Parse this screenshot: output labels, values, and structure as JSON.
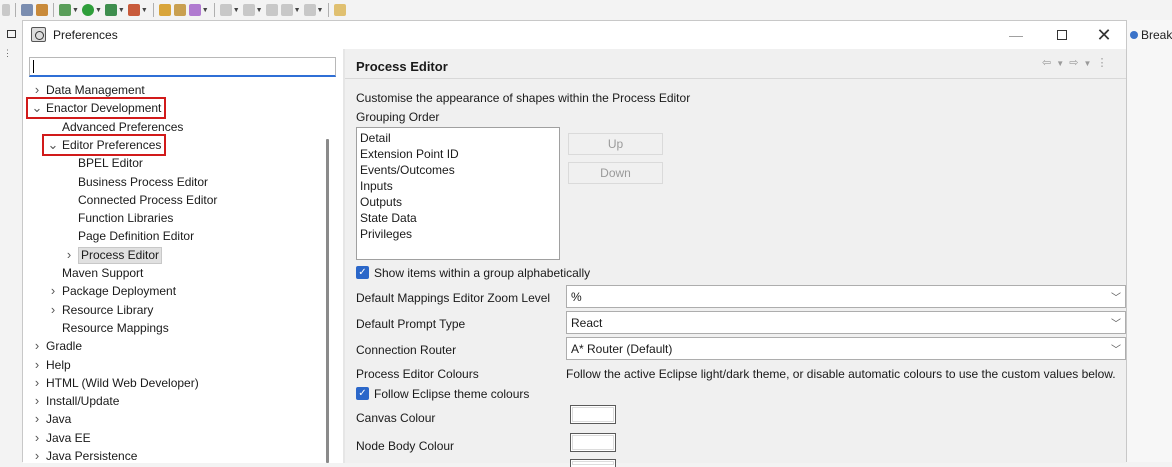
{
  "window": {
    "title": "Preferences",
    "minimize_icon": "minimize-icon",
    "maximize_icon": "maximize-icon",
    "close_icon": "close-icon"
  },
  "background": {
    "right_tab_label": "Breakp",
    "left_gutter_icon": "window-icon"
  },
  "filter": {
    "value": "",
    "placeholder": ""
  },
  "tree": [
    {
      "label": "Data Management",
      "expander": "collapsed"
    },
    {
      "label": "Enactor Development",
      "expander": "expanded",
      "highlighted": true
    },
    {
      "label": "Advanced Preferences",
      "expander": "none"
    },
    {
      "label": "Editor Preferences",
      "expander": "expanded",
      "highlighted": true
    },
    {
      "label": "BPEL Editor",
      "expander": "none"
    },
    {
      "label": "Business Process Editor",
      "expander": "none"
    },
    {
      "label": "Connected Process Editor",
      "expander": "none"
    },
    {
      "label": "Function Libraries",
      "expander": "none"
    },
    {
      "label": "Page Definition Editor",
      "expander": "none"
    },
    {
      "label": "Process Editor",
      "expander": "collapsed",
      "selected": true
    },
    {
      "label": "Maven Support",
      "expander": "none"
    },
    {
      "label": "Package Deployment",
      "expander": "collapsed"
    },
    {
      "label": "Resource Library",
      "expander": "collapsed"
    },
    {
      "label": "Resource Mappings",
      "expander": "none"
    },
    {
      "label": "Gradle",
      "expander": "collapsed"
    },
    {
      "label": "Help",
      "expander": "collapsed"
    },
    {
      "label": "HTML (Wild Web Developer)",
      "expander": "collapsed"
    },
    {
      "label": "Install/Update",
      "expander": "collapsed"
    },
    {
      "label": "Java",
      "expander": "collapsed"
    },
    {
      "label": "Java EE",
      "expander": "collapsed"
    },
    {
      "label": "Java Persistence",
      "expander": "collapsed"
    }
  ],
  "page": {
    "title": "Process Editor",
    "description": "Customise the appearance of shapes within the Process Editor",
    "grouping_label": "Grouping Order",
    "grouping_items": [
      "Detail",
      "Extension Point ID",
      "Events/Outcomes",
      "Inputs",
      "Outputs",
      "State Data",
      "Privileges"
    ],
    "up_label": "Up",
    "down_label": "Down",
    "alpha_checkbox_label": "Show items within a group alphabetically",
    "alpha_checked": true,
    "zoom_label": "Default Mappings Editor Zoom Level",
    "zoom_value": "%",
    "prompt_label": "Default Prompt Type",
    "prompt_value": "React",
    "router_label": "Connection Router",
    "router_value": "A* Router (Default)",
    "colours_label": "Process Editor Colours",
    "colours_hint": "Follow the active Eclipse light/dark theme, or disable automatic colours to use the custom values below.",
    "follow_theme_label": "Follow Eclipse theme colours",
    "follow_theme_checked": true,
    "canvas_label": "Canvas Colour",
    "canvas_colour": "#ffffff",
    "node_body_label": "Node Body Colour",
    "node_body_colour": "#ffffff"
  },
  "colors": {
    "highlight_box": "#d11a1a",
    "checkbox_accent": "#2b67c9",
    "filter_focus": "#2f6fd6"
  }
}
